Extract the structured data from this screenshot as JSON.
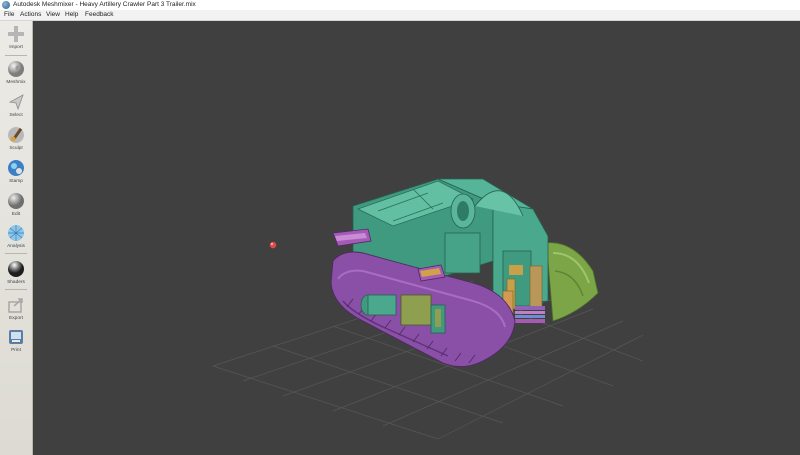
{
  "window": {
    "title": "Autodesk Meshmixer - Heavy Artillery Crawler Part 3 Trailer.mix"
  },
  "menu": {
    "items": [
      "File",
      "Actions",
      "View",
      "Help",
      "Feedback"
    ]
  },
  "toolbar": {
    "tools": [
      {
        "label": "Import",
        "icon": "plus-icon"
      },
      {
        "label": "Meshmix",
        "icon": "meshmix-sphere-icon"
      },
      {
        "label": "Select",
        "icon": "select-arrow-icon"
      },
      {
        "label": "Sculpt",
        "icon": "sculpt-brush-icon"
      },
      {
        "label": "Stamp",
        "icon": "stamp-icon"
      },
      {
        "label": "Edit",
        "icon": "edit-sphere-icon"
      },
      {
        "label": "Analysis",
        "icon": "analysis-sphere-icon"
      },
      {
        "label": "Shaders",
        "icon": "shaders-sphere-icon"
      },
      {
        "label": "Export",
        "icon": "export-icon"
      },
      {
        "label": "Print",
        "icon": "print-icon"
      }
    ]
  },
  "viewport": {
    "background": "#404040",
    "grid_color": "#5a5a5a",
    "model_colors": {
      "body": "#4fa58c",
      "tracks": "#8a4fa6",
      "trailer": "#7fa54a",
      "accent": "#c7a14a"
    },
    "pivot_color": "#e24a4a"
  }
}
